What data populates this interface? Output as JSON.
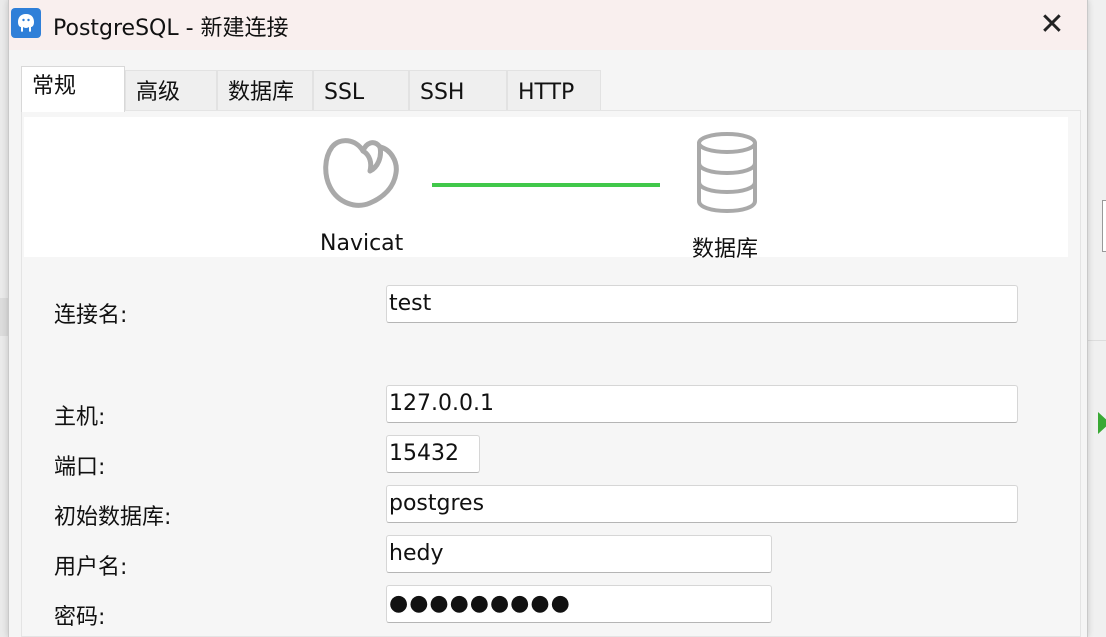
{
  "window": {
    "title": "PostgreSQL - 新建连接",
    "close_glyph": "✕",
    "app_icon": "postgresql-elephant-icon"
  },
  "tabs": [
    {
      "label": "常规",
      "active": true
    },
    {
      "label": "高级",
      "active": false
    },
    {
      "label": "数据库",
      "active": false
    },
    {
      "label": "SSL",
      "active": false
    },
    {
      "label": "SSH",
      "active": false
    },
    {
      "label": "HTTP",
      "active": false
    }
  ],
  "hero": {
    "left_label": "Navicat",
    "right_label": "数据库",
    "link_color": "#41c84a"
  },
  "form": {
    "connection_name": {
      "label": "连接名:",
      "value": "test"
    },
    "host": {
      "label": "主机:",
      "value": "127.0.0.1"
    },
    "port": {
      "label": "端口:",
      "value": "15432"
    },
    "initial_database": {
      "label": "初始数据库:",
      "value": "postgres"
    },
    "username": {
      "label": "用户名:",
      "value": "hedy"
    },
    "password": {
      "label": "密码:",
      "value": "●●●●●●●●●"
    }
  },
  "colors": {
    "titlebar": "#f9efee",
    "accent_line": "#41c84a",
    "app_icon_bg": "#2f7fd8"
  }
}
